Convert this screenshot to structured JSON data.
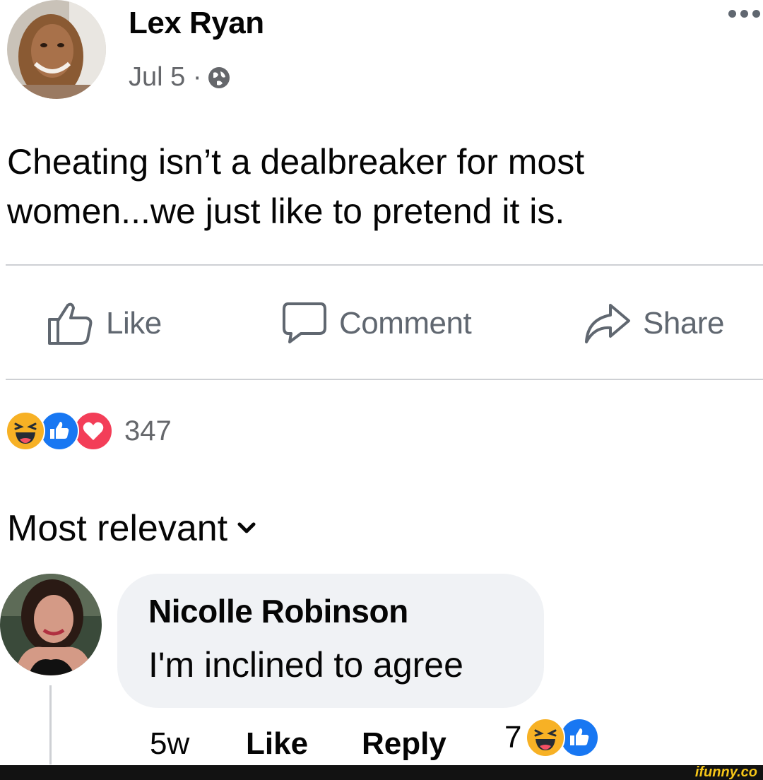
{
  "post": {
    "author": "Lex Ryan",
    "date": "Jul 5 ·",
    "privacy_icon": "globe-icon",
    "text_line1": "Cheating isn’t a dealbreaker for most",
    "text_line2": "women...we just like to pretend it is."
  },
  "actions": {
    "like_label": "Like",
    "comment_label": "Comment",
    "share_label": "Share"
  },
  "reactions": {
    "icons": [
      "haha-icon",
      "like-icon",
      "love-icon"
    ],
    "count": "347"
  },
  "comments_filter": {
    "label": "Most relevant"
  },
  "comment": {
    "author": "Nicolle Robinson",
    "text": "I'm inclined to agree",
    "age": "5w",
    "like_label": "Like",
    "reply_label": "Reply",
    "reaction_count": "7",
    "reaction_icons": [
      "haha-icon",
      "like-icon"
    ]
  },
  "watermark": "ifunny.co",
  "colors": {
    "like_blue": "#1877f2",
    "love_red": "#f33e58",
    "haha_yellow": "#f7b125",
    "bubble_gray": "#f0f2f5"
  }
}
